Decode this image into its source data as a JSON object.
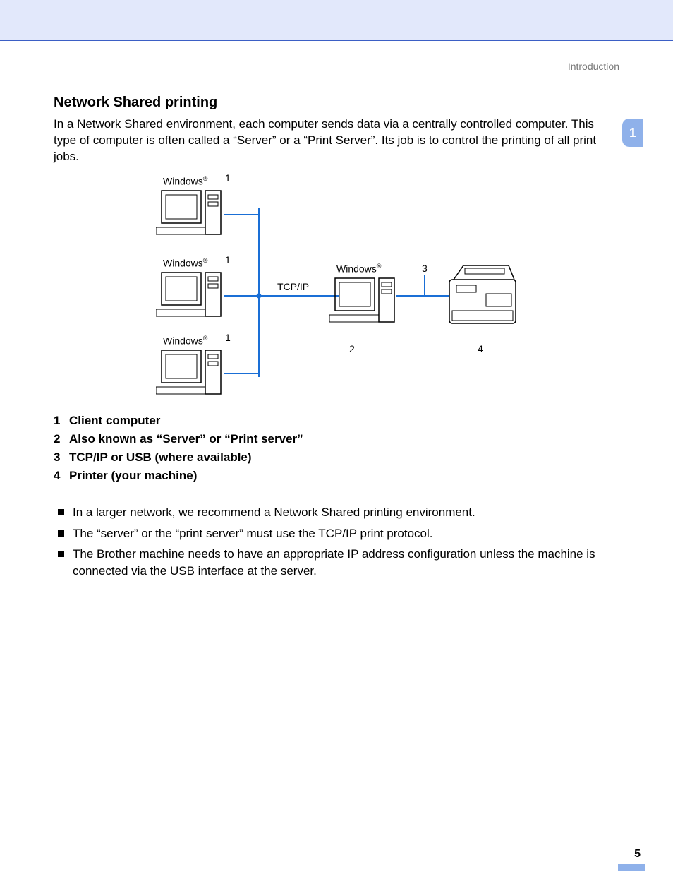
{
  "header": {
    "section": "Introduction"
  },
  "chapter": {
    "number": "1"
  },
  "section": {
    "title": "Network Shared printing",
    "intro": "In a Network Shared environment, each computer sends data via a centrally controlled computer. This type of computer is often called a “Server” or a “Print Server”. Its job is to control the printing of all print jobs."
  },
  "diagram": {
    "labels": {
      "client1_os": "Windows",
      "client1_num": "1",
      "client2_os": "Windows",
      "client2_num": "1",
      "client3_os": "Windows",
      "client3_num": "1",
      "server_os": "Windows",
      "server_num": "2",
      "link_label": "TCP/IP",
      "conn_num": "3",
      "printer_num": "4"
    }
  },
  "legend": [
    {
      "n": "1",
      "text": "Client computer"
    },
    {
      "n": "2",
      "text": "Also known as “Server” or “Print server”"
    },
    {
      "n": "3",
      "text": "TCP/IP or USB (where available)"
    },
    {
      "n": "4",
      "text": "Printer (your machine)"
    }
  ],
  "bullets": [
    "In a larger network, we recommend a Network Shared printing environment.",
    "The “server” or the “print server” must use the TCP/IP print protocol.",
    "The Brother machine needs to have an appropriate IP address configuration unless the machine is connected via the USB interface at the server."
  ],
  "page": {
    "num": "5"
  }
}
